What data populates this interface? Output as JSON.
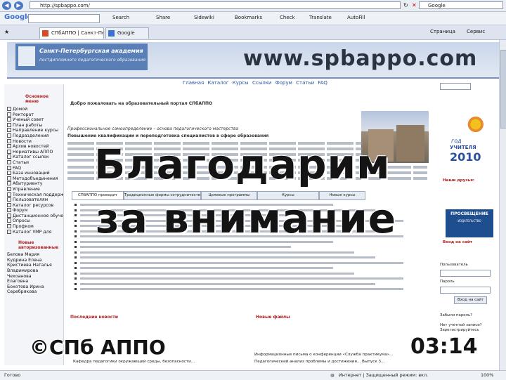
{
  "browser": {
    "address_url": "http://spbappo.com/",
    "search_placeholder": "Google",
    "google_toolbar": {
      "logo": "Google",
      "items": [
        "Search",
        "Share",
        "Sidewiki",
        "Bookmarks",
        "Check",
        "Translate",
        "AutoFill"
      ]
    },
    "tabs": [
      {
        "label": "СПбАППО | Санкт-Пе..."
      },
      {
        "label": "Google"
      }
    ],
    "tools": {
      "page": "Страница",
      "service": "Сервис"
    }
  },
  "site": {
    "brand_line1": "Санкт-Петербургская академия",
    "brand_line2": "постдипломного педагогического образования",
    "url_overlay": "www.spbappo.com",
    "topnav": [
      "Главная",
      "Каталог",
      "Курсы",
      "Ссылки",
      "Форум",
      "Статьи",
      "FAQ"
    ],
    "left_sidebar": {
      "title": "Основное меню",
      "items": [
        "Домой",
        "Ректорат",
        "Ученый совет",
        "План работы",
        "Направление курсы",
        "Подразделения",
        "Новости",
        "Архив новостей",
        "Нормативы АППО",
        "Каталог ссылок",
        "Статьи",
        "FAQ",
        "База инноваций",
        "Методобъединения",
        "Абитуриенту",
        "Управление",
        "Техническая поддержка",
        "Пользователям",
        "Каталог ресурсов",
        "Форум",
        "Дистанционное обучение",
        "Опросы",
        "Профком",
        "Каталог УМР для"
      ],
      "authors_title": "Новые авторизованные",
      "authors": [
        "Белова Мария",
        "Кудрина Елена",
        "Кристиева Наталья",
        "Владимирова",
        "Чехоанова",
        "Елаговна",
        "Бохотова Ирина",
        "Серебрякова"
      ]
    },
    "main": {
      "welcome": "Добро пожаловать на образовательный портал СПбАППО",
      "slogan": "Профессиональное самоопределение – основа педагогического мастерства",
      "subtitle": "Повышение квалификации и переподготовка специалистов в сфере образования",
      "tabs": [
        "СПбАППО проводит",
        "Традиционные формы сотрудничества",
        "Целевые программы",
        "Курсы",
        "Новые курсы"
      ],
      "news_heading": "Последние новости",
      "news_items": [
        "Кафедра педагогики окружающей среды, безопасности..."
      ],
      "files_heading": "Новые файлы",
      "files_items": [
        "Информационные письма о конференции «Служба практикума»...",
        "Педагогический анализ проблемы и достижения... Выпуск 3..."
      ]
    },
    "right_sidebar": {
      "year_line1": "год",
      "year_line2": "УЧИТЕЛЯ",
      "year_number": "2010",
      "our_friends": "Наши друзья:",
      "partner_name": "ПРОСВЕЩЕНИЕ",
      "partner_sub": "ИЗДАТЕЛЬСТВО",
      "login_title": "Вход на сайт",
      "login_label": "Пользователь",
      "password_label": "Пароль",
      "login_button": "Вход на сайт",
      "forgot": "Забыли пароль?",
      "register": "Нет учетной записи? Зарегистрируйтесь"
    }
  },
  "overlay": {
    "thanks_line1": "Благодарим",
    "thanks_line2": "за внимание",
    "copyright": "©СПб АППО",
    "clock": "03:14"
  },
  "status": {
    "done": "Готово",
    "zone": "Интернет | Защищенный режим: вкл.",
    "zoom": "100%"
  }
}
